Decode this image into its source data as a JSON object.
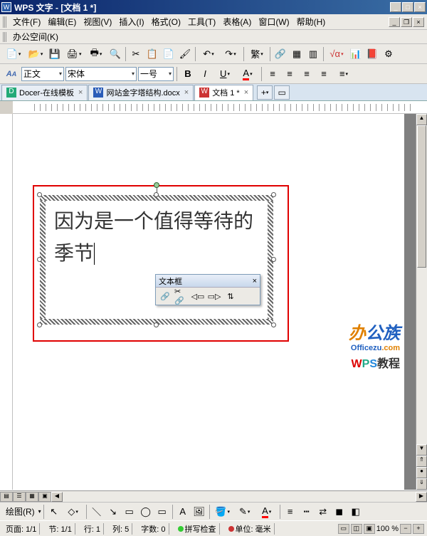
{
  "window": {
    "title": "WPS 文字 - [文档 1 *]"
  },
  "menu": {
    "file": "文件(F)",
    "edit": "编辑(E)",
    "view": "视图(V)",
    "insert": "插入(I)",
    "format": "格式(O)",
    "tools": "工具(T)",
    "table": "表格(A)",
    "window": "窗口(W)",
    "help": "帮助(H)",
    "workspace": "办公空间(K)"
  },
  "format": {
    "style_label": "正文",
    "font_label": "宋体",
    "size_label": "一号"
  },
  "tabs": [
    {
      "label": "Docer-在线模板"
    },
    {
      "label": "网站金字塔结构.docx"
    },
    {
      "label": "文档 1 *"
    }
  ],
  "textbox": {
    "content": "因为是一个值得等待的季节"
  },
  "toolbox": {
    "title": "文本框"
  },
  "watermark": {
    "brand": "办公族",
    "domain_pre": "Officezu",
    "domain_suf": ".com",
    "w": "W",
    "p": "P",
    "s": "S",
    "tutorial": "教程"
  },
  "drawbar": {
    "label": "绘图(R)"
  },
  "status": {
    "page": "页面: 1/1",
    "section": "节: 1/1",
    "row": "行: 1",
    "col": "列: 5",
    "chars": "字数: 0",
    "spell": "拼写检查",
    "unit": "单位: 毫米",
    "zoom": "100 %"
  }
}
